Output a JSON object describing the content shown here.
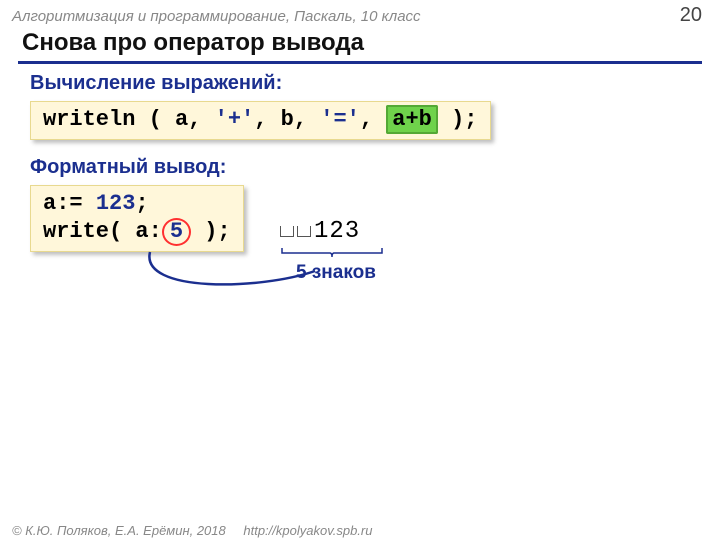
{
  "header": {
    "course": "Алгоритмизация и программирование, Паскаль, 10 класс",
    "page": "20"
  },
  "title": "Снова про оператор вывода",
  "sections": {
    "expr_heading": "Вычисление выражений:",
    "fmt_heading": "Форматный вывод:"
  },
  "code1": {
    "p1": "writeln ( a, ",
    "lit1": "'+'",
    "p2": ", b, ",
    "lit2": "'='",
    "p3": ", ",
    "hl": "a+b",
    "p4": " );"
  },
  "code2": {
    "l1a": "a:= ",
    "l1num": "123",
    "l1b": ";",
    "l2a": "write( a",
    "l2colon": ":",
    "l2w": "5",
    "l2b": " );"
  },
  "output": {
    "digits": "123"
  },
  "annot": "5 знаков",
  "footer": {
    "copyright": "© К.Ю. Поляков, Е.А. Ерёмин, 2018",
    "url": "http://kpolyakov.spb.ru"
  }
}
